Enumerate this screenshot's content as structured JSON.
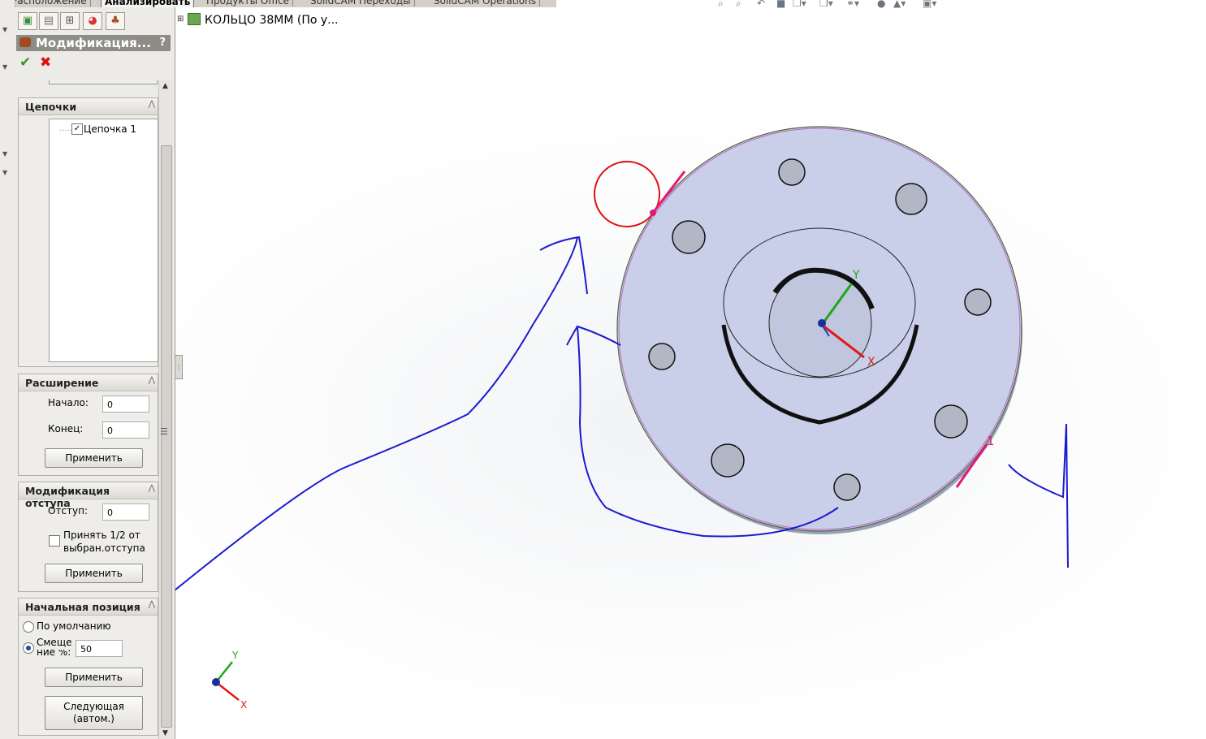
{
  "top_tabs": [
    {
      "label": "Расположение",
      "active": false
    },
    {
      "label": "Анализировать",
      "active": true
    },
    {
      "label": "Продукты Office",
      "active": false
    },
    {
      "label": "SolidCAM Переходы",
      "active": false
    },
    {
      "label": "SolidCAM Operations",
      "active": false
    }
  ],
  "property_manager": {
    "title": "Модификация...",
    "help": "?",
    "ok_symbol": "✔",
    "cancel_symbol": "✖",
    "groups": {
      "chains": {
        "title": "Цепочки",
        "items": [
          {
            "label": "Цепочка 1",
            "checked": true
          }
        ]
      },
      "extension": {
        "title": "Расширение",
        "start_label": "Начало:",
        "start_value": "0",
        "end_label": "Конец:",
        "end_value": "0",
        "apply": "Применить"
      },
      "offset_mod": {
        "title": "Модификация отступа",
        "offset_label": "Отступ:",
        "offset_value": "0",
        "half_offset_line1": "Принять 1/2 от",
        "half_offset_line2": "выбран.отступа",
        "half_offset_checked": false,
        "apply": "Применить"
      },
      "start_position": {
        "title": "Начальная позиция",
        "default_label": "По умолчанию",
        "offset_pct_line1": "Смеще",
        "offset_pct_line2": "ние %:",
        "offset_pct_value": "50",
        "selected": "offset_pct",
        "apply": "Применить",
        "next_line1": "Следующая",
        "next_line2": "(автом.)"
      }
    }
  },
  "feature_tree": {
    "expander": "⊞",
    "root_label": "КОЛЬЦО 38ММ  (По у..."
  },
  "viewport": {
    "triad_labels": {
      "x": "X",
      "y": "Y"
    },
    "part_axes_labels": {
      "x": "X",
      "y": "Y"
    },
    "chain_end_label": "1",
    "colors": {
      "face": "#c8cfe8",
      "x_axis": "#e01a1a",
      "y_axis": "#1aa81a",
      "z_axis": "#1a3fd0",
      "annotation_ink": "#1a1ad0",
      "arrow_pink": "#e0197a",
      "start_circle": "#e01010"
    }
  },
  "icons": {
    "pm_tabs": [
      "feature-manager-icon",
      "property-manager-icon",
      "configuration-manager-icon",
      "appearance-icon",
      "cam-manager-icon"
    ],
    "toolbar": [
      "zoom-to-fit-icon",
      "zoom-area-icon",
      "previous-view-icon",
      "section-view-icon",
      "view-orientation-icon",
      "display-style-icon",
      "hide-show-icon",
      "edit-appearance-icon",
      "apply-scene-icon",
      "view-settings-icon"
    ]
  }
}
